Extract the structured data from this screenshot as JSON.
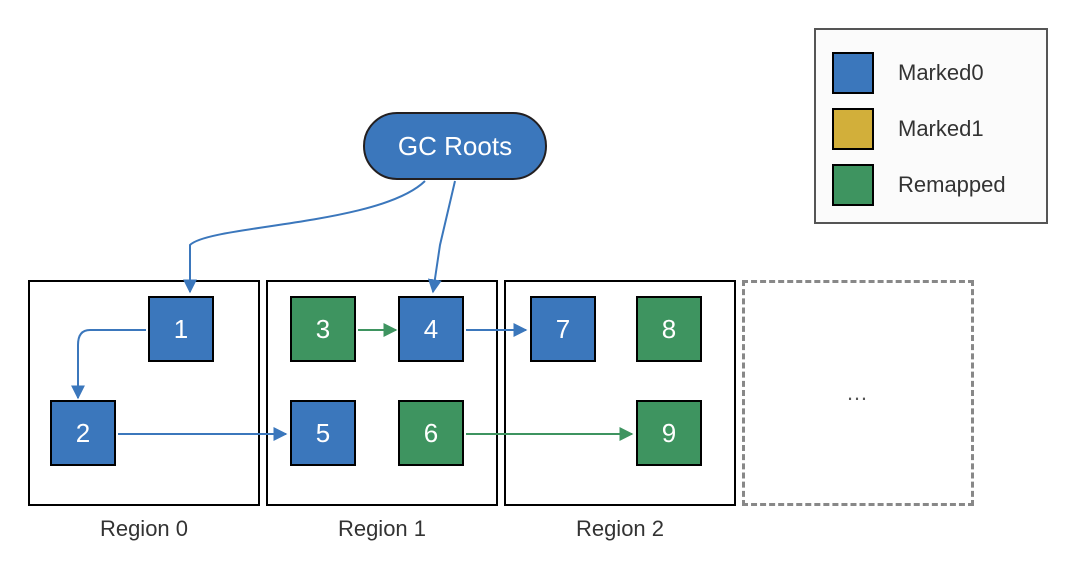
{
  "root_label": "GC Roots",
  "legend": {
    "marked0": "Marked0",
    "marked1": "Marked1",
    "remapped": "Remapped"
  },
  "colors": {
    "marked0": "#3b77bc",
    "marked1": "#d2af3a",
    "remapped": "#3e9460",
    "arrow_blue": "#3b77bc",
    "arrow_green": "#3e9460"
  },
  "regions": {
    "r0": {
      "label": "Region 0"
    },
    "r1": {
      "label": "Region 1"
    },
    "r2": {
      "label": "Region 2"
    },
    "empty": {
      "label": "…"
    }
  },
  "cells": {
    "c1": {
      "text": "1",
      "state": "marked0",
      "region": "r0"
    },
    "c2": {
      "text": "2",
      "state": "marked0",
      "region": "r0"
    },
    "c3": {
      "text": "3",
      "state": "remapped",
      "region": "r1"
    },
    "c4": {
      "text": "4",
      "state": "marked0",
      "region": "r1"
    },
    "c5": {
      "text": "5",
      "state": "marked0",
      "region": "r1"
    },
    "c6": {
      "text": "6",
      "state": "remapped",
      "region": "r1"
    },
    "c7": {
      "text": "7",
      "state": "marked0",
      "region": "r2"
    },
    "c8": {
      "text": "8",
      "state": "remapped",
      "region": "r2"
    },
    "c9": {
      "text": "9",
      "state": "remapped",
      "region": "r2"
    }
  },
  "edges": [
    {
      "from": "root",
      "to": "c1",
      "color": "blue"
    },
    {
      "from": "root",
      "to": "c4",
      "color": "blue"
    },
    {
      "from": "c1",
      "to": "c2",
      "color": "blue"
    },
    {
      "from": "c2",
      "to": "c5",
      "color": "blue"
    },
    {
      "from": "c3",
      "to": "c4",
      "color": "green"
    },
    {
      "from": "c4",
      "to": "c7",
      "color": "blue"
    },
    {
      "from": "c6",
      "to": "c9",
      "color": "green"
    }
  ]
}
